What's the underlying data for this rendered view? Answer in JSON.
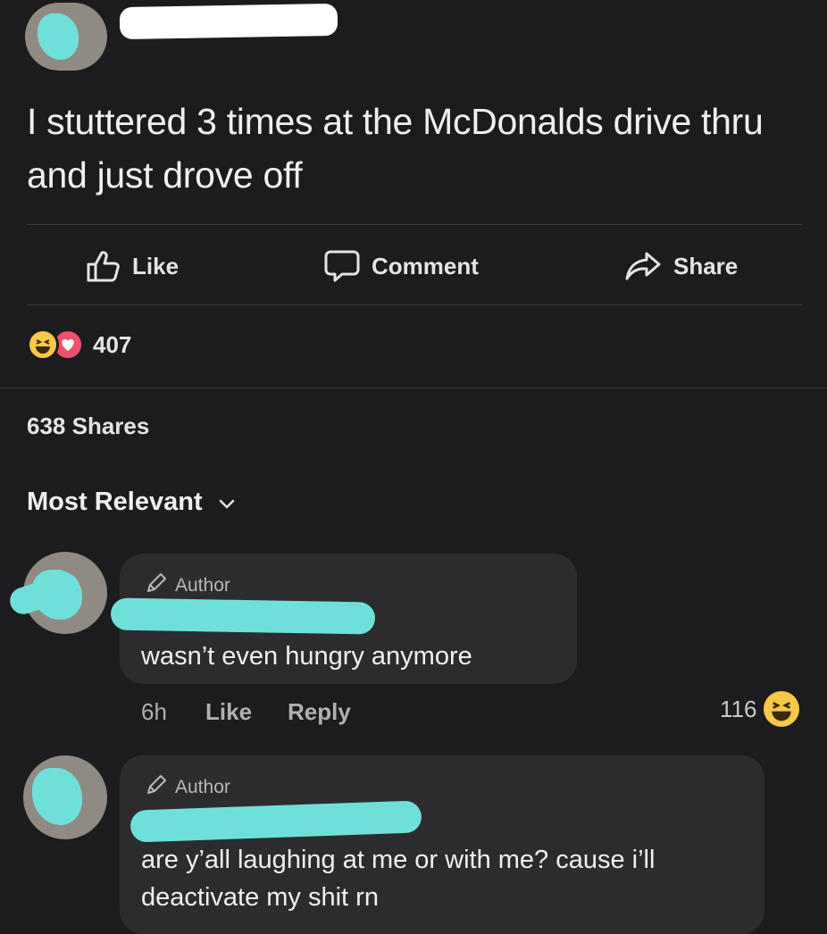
{
  "post": {
    "text": "I stuttered 3 times at the McDonalds drive thru and just drove off"
  },
  "actions": {
    "like_label": "Like",
    "comment_label": "Comment",
    "share_label": "Share"
  },
  "stats": {
    "reaction_count": "407",
    "shares_text": "638 Shares",
    "reaction_icons": [
      "haha-icon",
      "love-icon"
    ]
  },
  "sort": {
    "label": "Most Relevant"
  },
  "comments": [
    {
      "badge": "Author",
      "text": "wasn’t even hungry anymore",
      "time": "6h",
      "like_label": "Like",
      "reply_label": "Reply",
      "reaction_count": "116",
      "reaction_icon": "haha-icon"
    },
    {
      "badge": "Author",
      "text": "are y’all laughing at me or with me? cause i’ll deactivate my shit rn"
    }
  ],
  "colors": {
    "background": "#1c1c1e",
    "bubble": "#2c2c2f",
    "redaction_teal": "#6fe0d9",
    "haha_yellow": "#f7c948",
    "love_pink": "#f0506e"
  }
}
